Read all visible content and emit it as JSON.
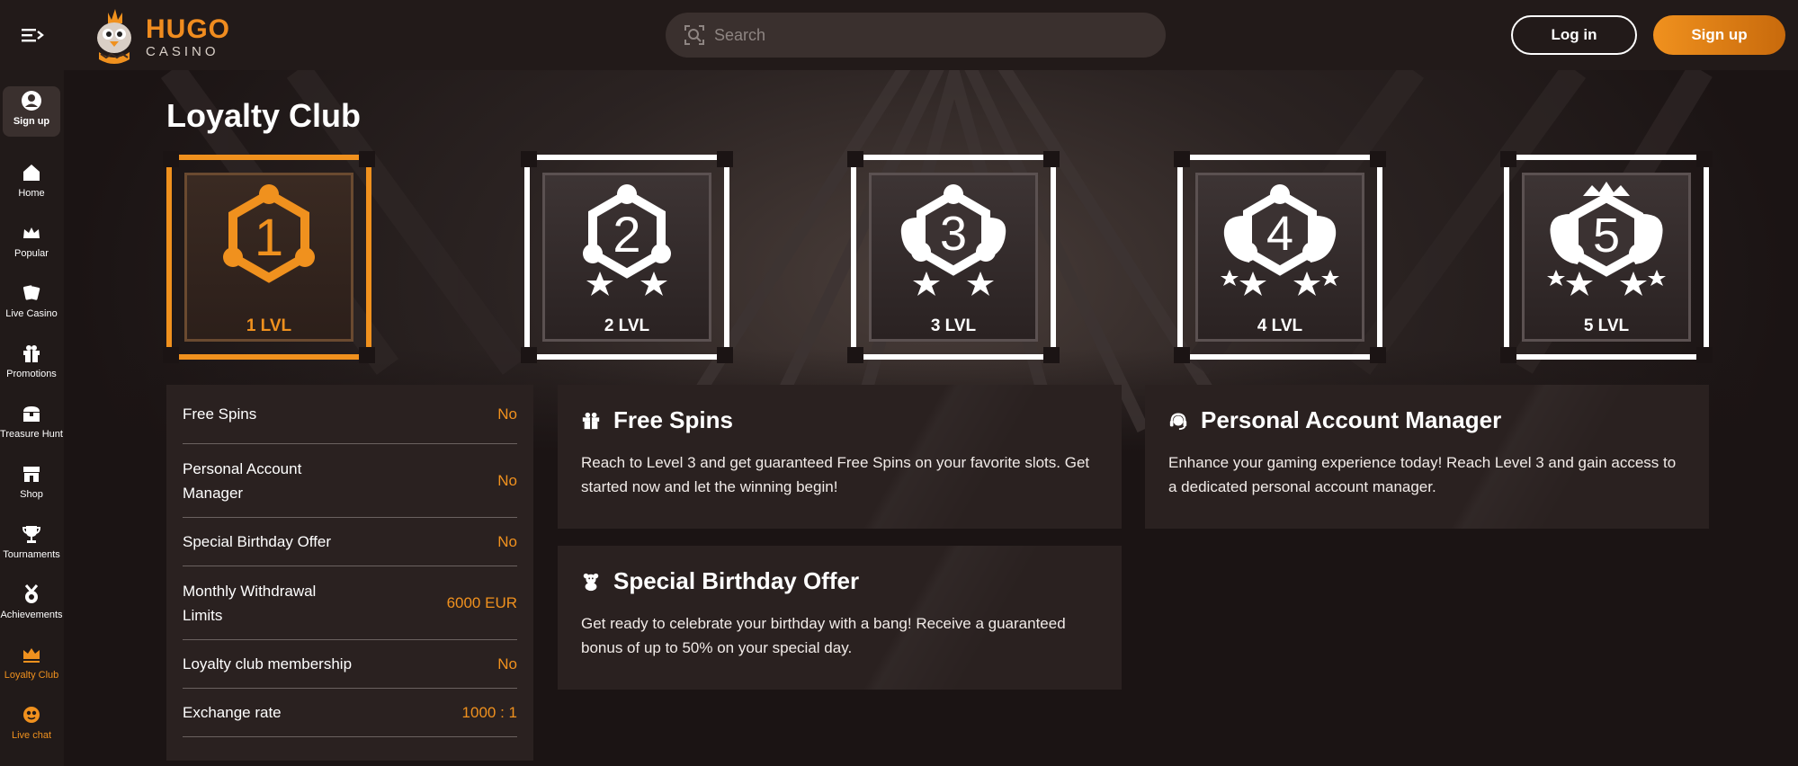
{
  "header": {
    "logo": {
      "name": "HUGO",
      "sub": "CASINO"
    },
    "search": {
      "placeholder": "Search"
    },
    "login_label": "Log in",
    "signup_label": "Sign up"
  },
  "sidebar": {
    "signup_label": "Sign up",
    "items": [
      {
        "label": "Home",
        "icon": "home-icon"
      },
      {
        "label": "Popular",
        "icon": "crown-icon"
      },
      {
        "label": "Live Casino",
        "icon": "cards-icon"
      },
      {
        "label": "Promotions",
        "icon": "gift-icon"
      },
      {
        "label": "Treasure Hunt",
        "icon": "treasure-chest-icon"
      },
      {
        "label": "Shop",
        "icon": "shop-icon"
      },
      {
        "label": "Tournaments",
        "icon": "trophy-icon"
      },
      {
        "label": "Achievements",
        "icon": "medal-icon"
      },
      {
        "label": "Loyalty Club",
        "icon": "crown-icon",
        "active": true
      },
      {
        "label": "Live chat",
        "icon": "chat-icon"
      }
    ]
  },
  "page": {
    "title": "Loyalty Club"
  },
  "levels": [
    {
      "number": "1",
      "label": "1 LVL",
      "active": true
    },
    {
      "number": "2",
      "label": "2 LVL"
    },
    {
      "number": "3",
      "label": "3 LVL"
    },
    {
      "number": "4",
      "label": "4 LVL"
    },
    {
      "number": "5",
      "label": "5 LVL"
    }
  ],
  "benefits_table": [
    {
      "key": "Free Spins",
      "value": "No"
    },
    {
      "key": "Personal Account Manager",
      "value": "No"
    },
    {
      "key": "Special Birthday Offer",
      "value": "No"
    },
    {
      "key": "Monthly Withdrawal Limits",
      "value": "6000 EUR"
    },
    {
      "key": "Loyalty club membership",
      "value": "No"
    },
    {
      "key": "Exchange rate",
      "value": "1000 : 1"
    }
  ],
  "cards": {
    "free_spins": {
      "title": "Free Spins",
      "icon": "gift-icon",
      "text": "Reach to Level 3 and get guaranteed Free Spins on your favorite slots. Get started now and let the winning begin!"
    },
    "account_manager": {
      "title": "Personal Account Manager",
      "icon": "headset-icon",
      "text": "Enhance your gaming experience today! Reach Level 3 and gain access to a dedicated personal account manager."
    },
    "birthday": {
      "title": "Special Birthday Offer",
      "icon": "teddy-bear-icon",
      "text": "Get ready to celebrate your birthday with a bang! Receive a guaranteed bonus of up to 50% on your special day."
    }
  },
  "colors": {
    "accent": "#f0911e",
    "background": "#1b1414",
    "panel": "#2a2120"
  }
}
